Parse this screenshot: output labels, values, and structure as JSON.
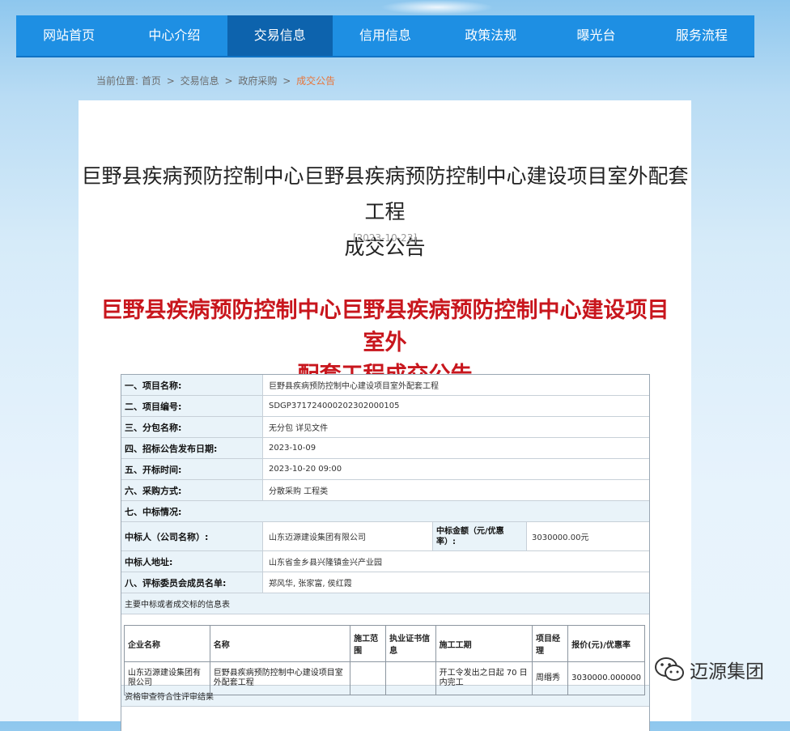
{
  "nav": {
    "items": [
      "网站首页",
      "中心介绍",
      "交易信息",
      "信用信息",
      "政策法规",
      "曝光台",
      "服务流程"
    ],
    "active_index": 2
  },
  "breadcrumb": {
    "prefix": "当前位置:",
    "items": [
      "首页",
      "交易信息",
      "政府采购"
    ],
    "current": "成交公告",
    "separator": ">"
  },
  "article": {
    "title_line1": "巨野县疾病预防控制中心巨野县疾病预防控制中心建设项目室外配套工程",
    "title_line2": "成交公告",
    "date": "[2023-10-23]",
    "red_title_line1": "巨野县疾病预防控制中心巨野县疾病预防控制中心建设项目室外",
    "red_title_line2": "配套工程成交公告"
  },
  "info": {
    "rows": [
      {
        "label": "一、项目名称:",
        "value": "巨野县疾病预防控制中心建设项目室外配套工程"
      },
      {
        "label": "二、项目编号:",
        "value": "SDGP371724000202302000105"
      },
      {
        "label": "三、分包名称:",
        "value": "无分包 详见文件"
      },
      {
        "label": "四、招标公告发布日期:",
        "value": "2023-10-09"
      },
      {
        "label": "五、开标时间:",
        "value": "2023-10-20 09:00"
      },
      {
        "label": "六、采购方式:",
        "value": "分散采购 工程类"
      }
    ],
    "section7": "七、中标情况:",
    "winner_label": "中标人（公司名称）:",
    "winner_value": "山东迈源建设集团有限公司",
    "amount_label": "中标金额（元/优惠率）:",
    "amount_value": "3030000.00元",
    "address_label": "中标人地址:",
    "address_value": "山东省金乡县兴隆镇金兴产业园",
    "committee_label": "八、评标委员会成员名单:",
    "committee_value": "郑风华, 张家富, 侯红霞",
    "subhead": "主要中标或者成交标的信息表",
    "table_headers": [
      "企业名称",
      "名称",
      "施工范围",
      "执业证书信息",
      "施工工期",
      "项目经理",
      "报价(元)/优惠率"
    ],
    "table_row": [
      "山东迈源建设集团有限公司",
      "巨野县疾病预防控制中心建设项目室外配套工程",
      "",
      "",
      "开工令发出之日起 70 日内完工",
      "周缗秀",
      "3030000.000000"
    ],
    "footer": "资格审查符合性评审结果"
  },
  "watermark": {
    "text": "迈源集团",
    "icon": "wechat-icon"
  }
}
